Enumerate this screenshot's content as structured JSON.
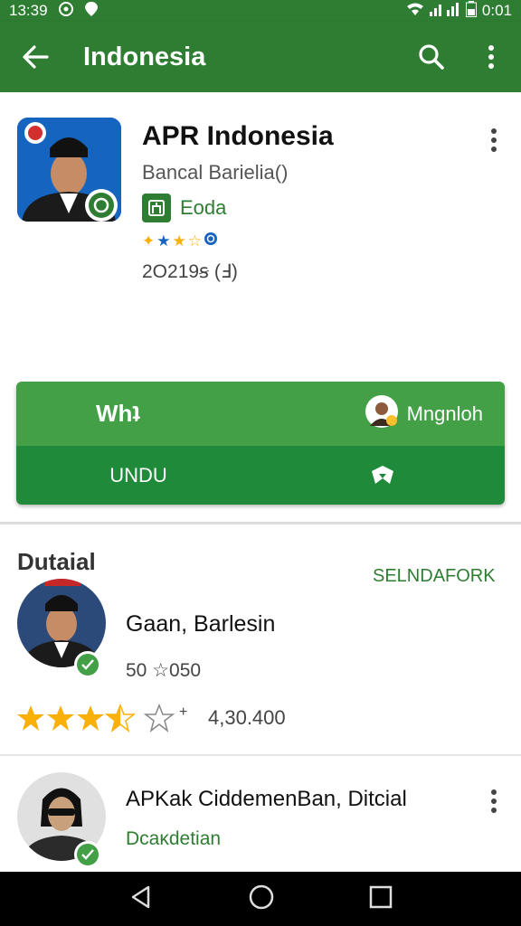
{
  "status": {
    "time": "13:39",
    "battery_time": "0:01"
  },
  "appbar": {
    "title": "Indonesia"
  },
  "app": {
    "title": "APR Indonesia",
    "developer": "Bancal Barielia()",
    "badge": "Eoda",
    "downloads": "2O219ꞩ (Ⅎ)"
  },
  "install": {
    "primary_label": "Whʇ",
    "user_label": "Mngnloh",
    "secondary_label": "UNDU"
  },
  "details": {
    "heading": "Dutaial",
    "link": "SELNDAFORK",
    "person1": {
      "name": "Gaan, Barlesin",
      "meta": "50 ☆050",
      "rating": 3.5,
      "rating_value": "4,30.400"
    },
    "person2": {
      "name": "APKak CiddemenBan, Ditcial",
      "subtitle": "Dcaκdetian"
    }
  },
  "colors": {
    "primary": "#2e7d32",
    "accent": "#43a047",
    "star": "#f9b10a"
  }
}
